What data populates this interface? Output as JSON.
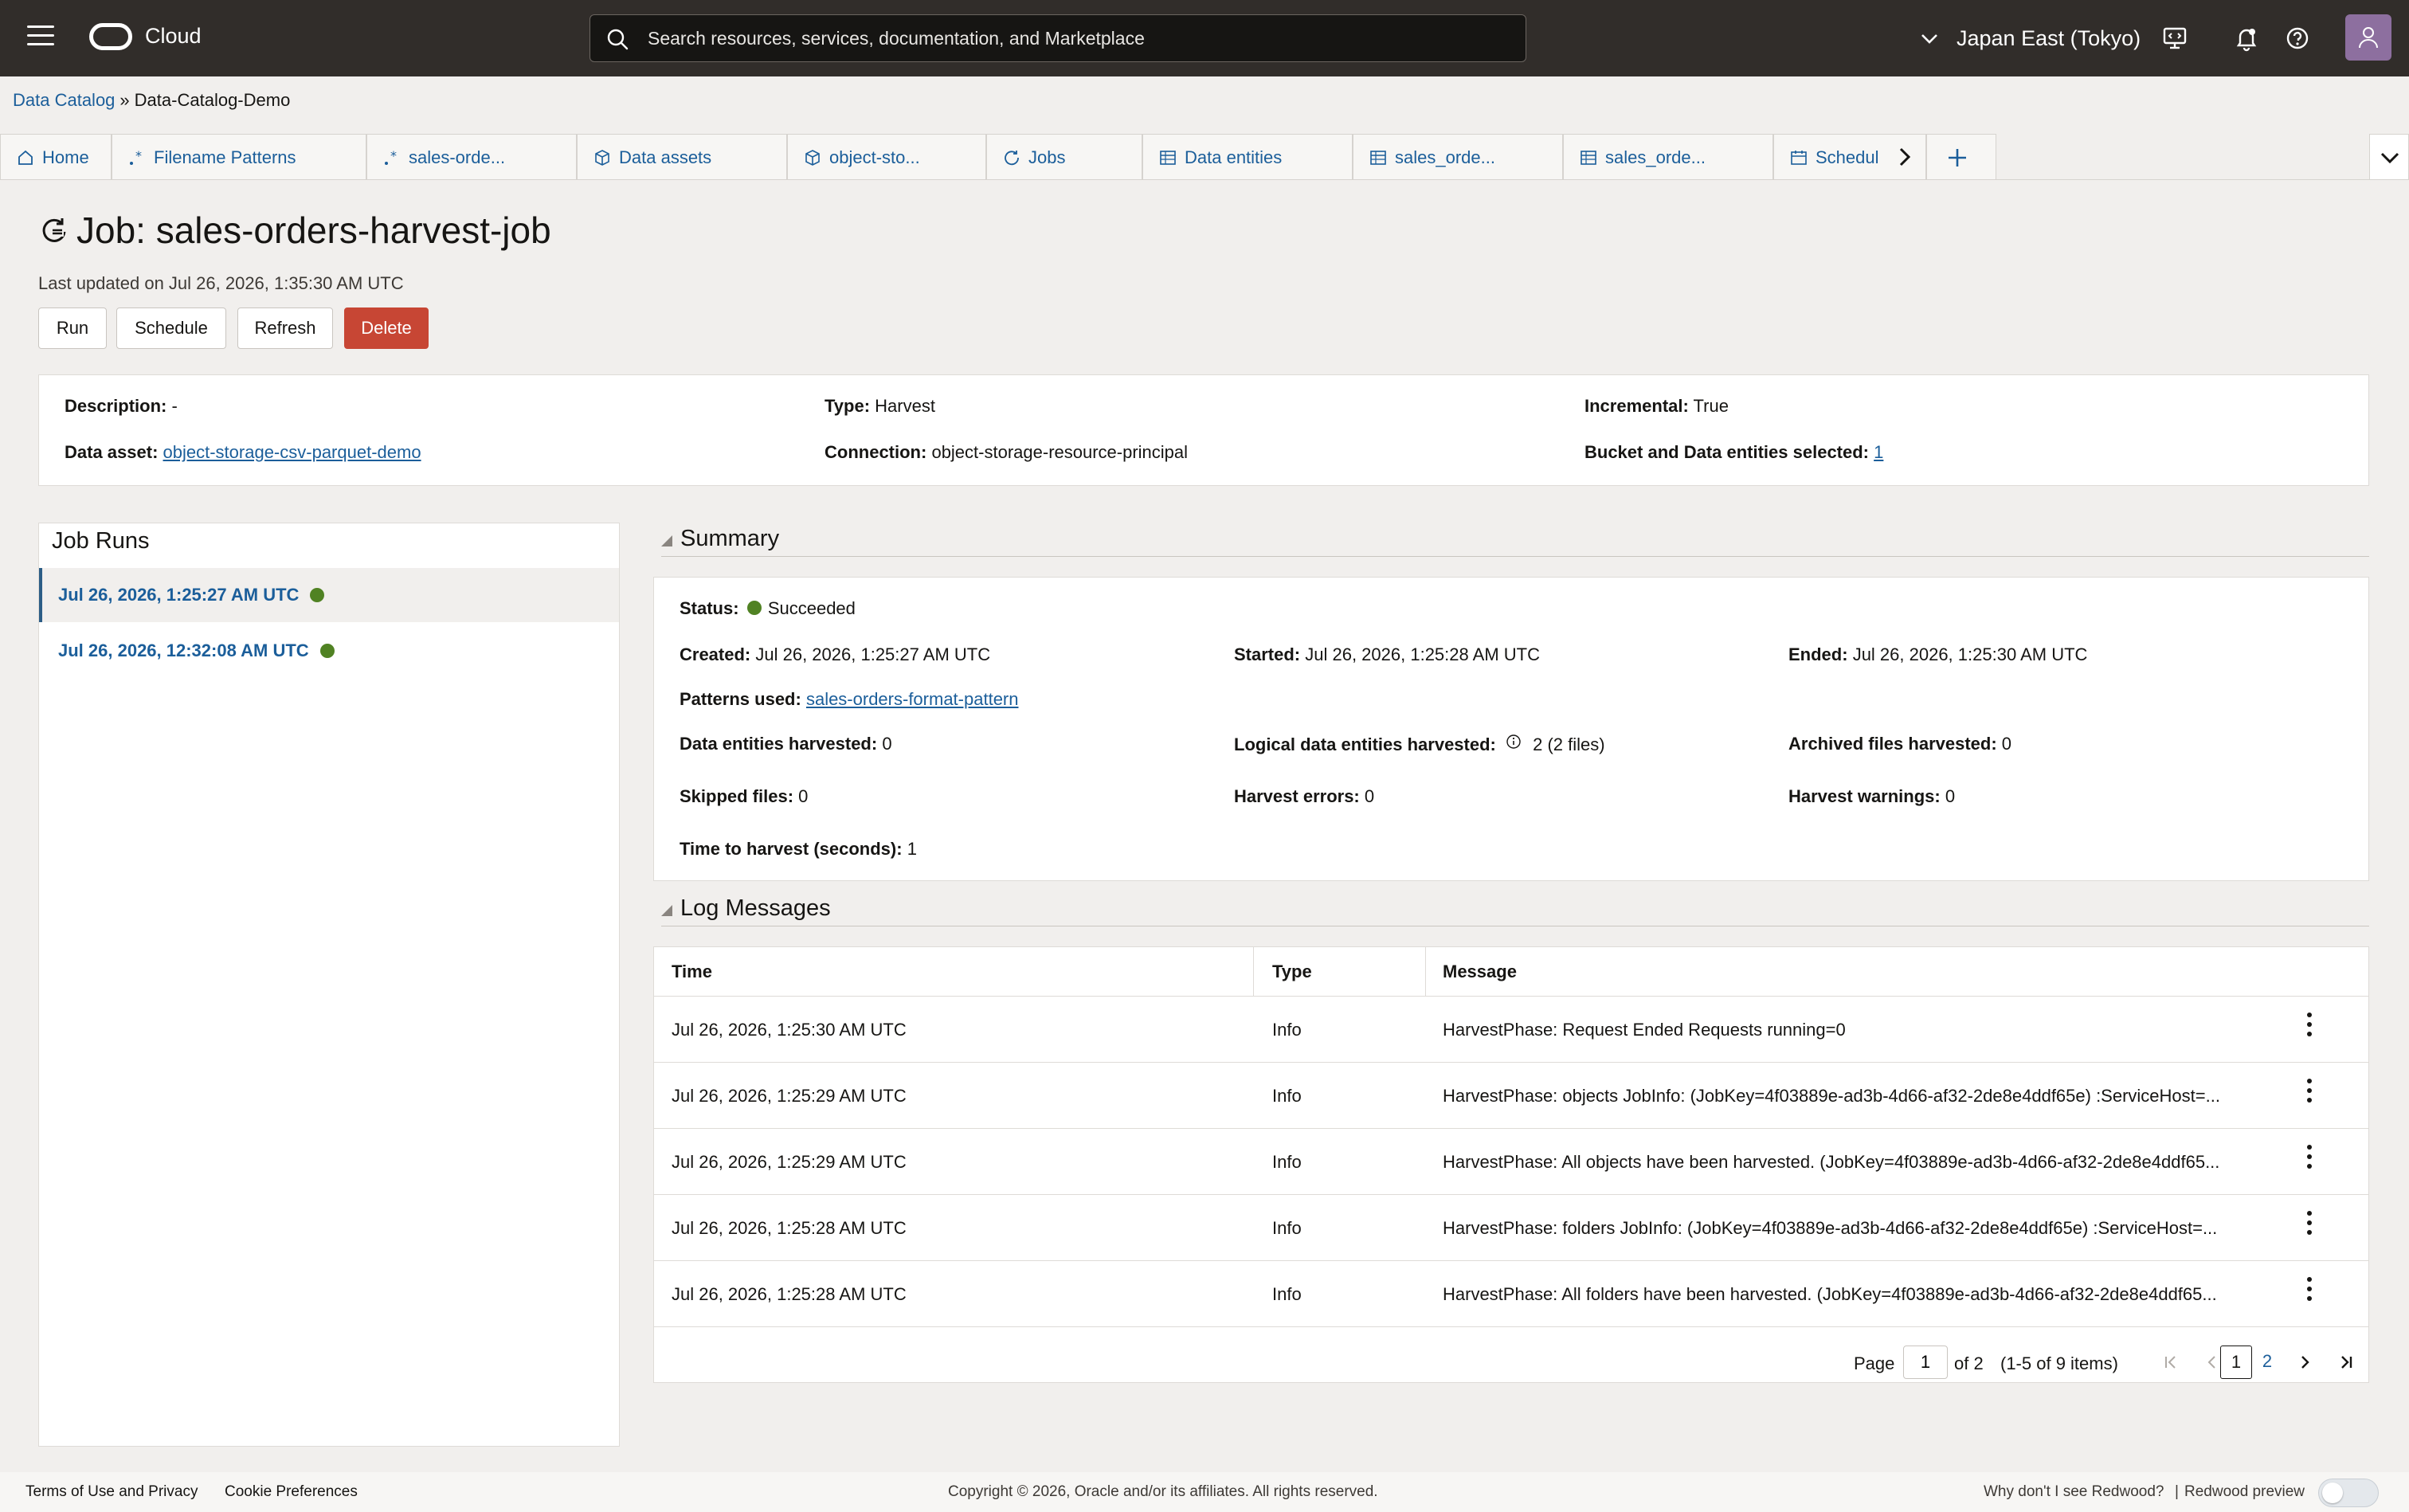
{
  "topbar": {
    "brand": "Cloud",
    "search_placeholder": "Search resources, services, documentation, and Marketplace",
    "region": "Japan East (Tokyo)"
  },
  "breadcrumb": {
    "root": "Data Catalog",
    "separator": "»",
    "current": "Data-Catalog-Demo"
  },
  "tabs": [
    {
      "label": "Home",
      "icon": "home-icon"
    },
    {
      "label": "Filename Patterns",
      "icon": "pattern-icon"
    },
    {
      "label": "sales-orde...",
      "icon": "pattern-icon"
    },
    {
      "label": "Data assets",
      "icon": "cube-icon"
    },
    {
      "label": "object-sto...",
      "icon": "cube-icon"
    },
    {
      "label": "Jobs",
      "icon": "job-icon"
    },
    {
      "label": "Data entities",
      "icon": "table-icon"
    },
    {
      "label": "sales_orde...",
      "icon": "table-icon"
    },
    {
      "label": "sales_orde...",
      "icon": "table-icon"
    },
    {
      "label": "Schedul",
      "icon": "calendar-icon"
    }
  ],
  "page": {
    "title": "Job: sales-orders-harvest-job",
    "updated": "Last updated on Jul 26, 2026, 1:35:30 AM UTC",
    "buttons": {
      "run": "Run",
      "schedule": "Schedule",
      "refresh": "Refresh",
      "delete": "Delete"
    }
  },
  "details": {
    "description_label": "Description:",
    "description": "-",
    "data_asset_label": "Data asset:",
    "data_asset": "object-storage-csv-parquet-demo",
    "type_label": "Type:",
    "type": "Harvest",
    "connection_label": "Connection:",
    "connection": "object-storage-resource-principal",
    "incremental_label": "Incremental:",
    "incremental": "True",
    "bucket_label": "Bucket and Data entities selected:",
    "bucket": "1"
  },
  "job_runs": {
    "title": "Job Runs",
    "runs": [
      {
        "label": "Jul 26, 2026, 1:25:27 AM UTC",
        "status_color": "#508223"
      },
      {
        "label": "Jul 26, 2026, 12:32:08 AM UTC",
        "status_color": "#508223"
      }
    ]
  },
  "summary": {
    "title": "Summary",
    "status_label": "Status:",
    "status": "Succeeded",
    "created_label": "Created:",
    "created": "Jul 26, 2026, 1:25:27 AM UTC",
    "started_label": "Started:",
    "started": "Jul 26, 2026, 1:25:28 AM UTC",
    "ended_label": "Ended:",
    "ended": "Jul 26, 2026, 1:25:30 AM UTC",
    "patterns_label": "Patterns used:",
    "patterns": "sales-orders-format-pattern",
    "entities_label": "Data entities harvested:",
    "entities": "0",
    "logical_label": "Logical data entities harvested:",
    "logical": "2 (2 files)",
    "archived_label": "Archived files harvested:",
    "archived": "0",
    "skipped_label": "Skipped files:",
    "skipped": "0",
    "errors_label": "Harvest errors:",
    "errors": "0",
    "warnings_label": "Harvest warnings:",
    "warnings": "0",
    "time_label": "Time to harvest (seconds):",
    "time": "1"
  },
  "log": {
    "title": "Log Messages",
    "columns": {
      "time": "Time",
      "type": "Type",
      "message": "Message"
    },
    "rows": [
      {
        "time": "Jul 26, 2026, 1:25:30 AM UTC",
        "type": "Info",
        "message": "HarvestPhase: Request Ended Requests running=0"
      },
      {
        "time": "Jul 26, 2026, 1:25:29 AM UTC",
        "type": "Info",
        "message": "HarvestPhase: objects JobInfo: (JobKey=4f03889e-ad3b-4d66-af32-2de8e4ddf65e) :ServiceHost=..."
      },
      {
        "time": "Jul 26, 2026, 1:25:29 AM UTC",
        "type": "Info",
        "message": "HarvestPhase: All objects have been harvested. (JobKey=4f03889e-ad3b-4d66-af32-2de8e4ddf65..."
      },
      {
        "time": "Jul 26, 2026, 1:25:28 AM UTC",
        "type": "Info",
        "message": "HarvestPhase: folders JobInfo: (JobKey=4f03889e-ad3b-4d66-af32-2de8e4ddf65e) :ServiceHost=..."
      },
      {
        "time": "Jul 26, 2026, 1:25:28 AM UTC",
        "type": "Info",
        "message": "HarvestPhase: All folders have been harvested. (JobKey=4f03889e-ad3b-4d66-af32-2de8e4ddf65..."
      }
    ],
    "pager": {
      "page_label": "Page",
      "page": "1",
      "of": "of 2",
      "range": "(1-5 of 9 items)",
      "p1": "1",
      "p2": "2"
    }
  },
  "footer": {
    "terms": "Terms of Use and Privacy",
    "cookies": "Cookie Preferences",
    "copyright": "Copyright © 2026, Oracle and/or its affiliates. All rights reserved.",
    "redwood_q": "Why don't I see Redwood?",
    "divider": "|",
    "redwood_preview": "Redwood preview"
  }
}
